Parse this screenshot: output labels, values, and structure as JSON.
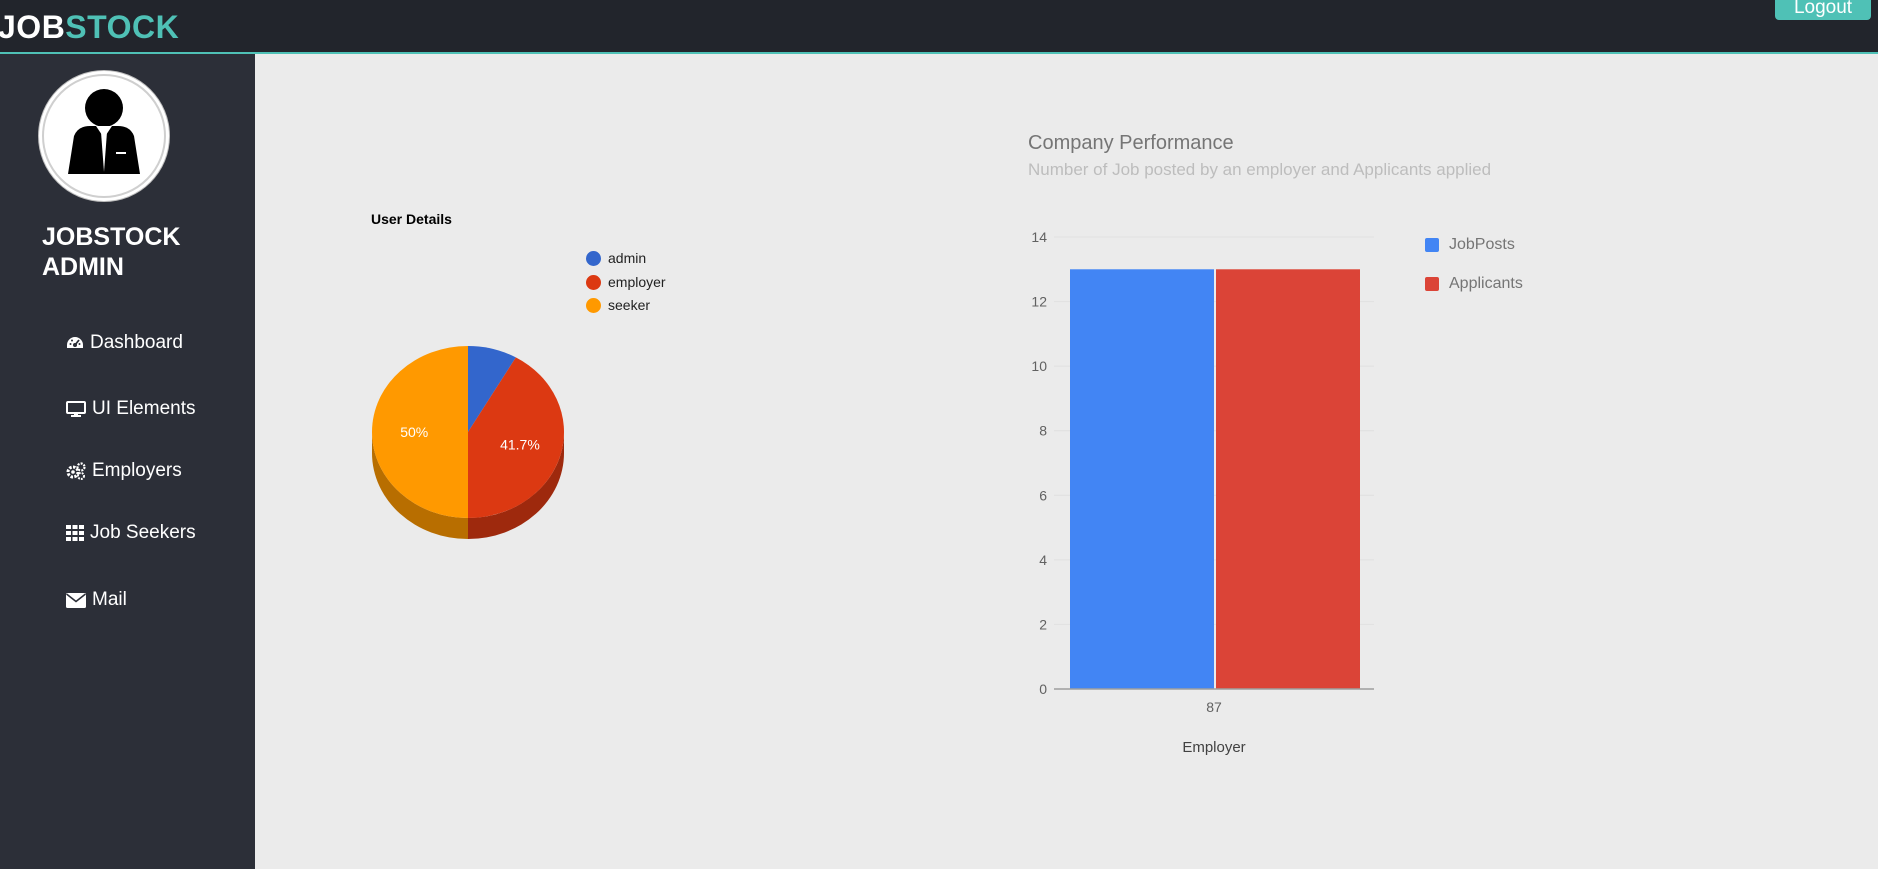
{
  "header": {
    "logo_part1": "JOB",
    "logo_part2": "STOCK",
    "logout_label": "Logout"
  },
  "sidebar": {
    "avatar_icon": "admin-avatar-icon",
    "admin_line1": "JOBSTOCK",
    "admin_line2": "ADMIN",
    "items": [
      {
        "label": "Dashboard",
        "icon": "dashboard-icon"
      },
      {
        "label": "UI Elements",
        "icon": "monitor-icon"
      },
      {
        "label": "Employers",
        "icon": "gears-icon"
      },
      {
        "label": "Job Seekers",
        "icon": "grid-icon"
      },
      {
        "label": "Mail",
        "icon": "envelope-icon"
      }
    ]
  },
  "colors": {
    "accent": "#4fc1b6",
    "admin": "#3366cc",
    "employer": "#dc3912",
    "seeker": "#ff9900",
    "jobposts": "#4285f4",
    "applicants": "#db4437"
  },
  "pie_chart": {
    "title": "User Details",
    "slice_labels": [
      "",
      "41.7%",
      "50%"
    ]
  },
  "bar_chart": {
    "title": "Company Performance",
    "subtitle": "Number of Job posted by an employer and Applicants applied"
  },
  "chart_data": [
    {
      "type": "pie",
      "title": "User Details",
      "categories": [
        "admin",
        "employer",
        "seeker"
      ],
      "values": [
        8.3,
        41.7,
        50
      ],
      "legend": "right"
    },
    {
      "type": "bar",
      "title": "Company Performance",
      "subtitle": "Number of Job posted by an employer and Applicants applied",
      "categories": [
        "87"
      ],
      "series": [
        {
          "name": "JobPosts",
          "values": [
            13
          ]
        },
        {
          "name": "Applicants",
          "values": [
            13
          ]
        }
      ],
      "xlabel": "Employer",
      "ylabel": "",
      "ylim": [
        0,
        14
      ],
      "yticks": [
        0,
        2,
        4,
        6,
        8,
        10,
        12,
        14
      ],
      "grid": true,
      "legend": "right"
    }
  ]
}
